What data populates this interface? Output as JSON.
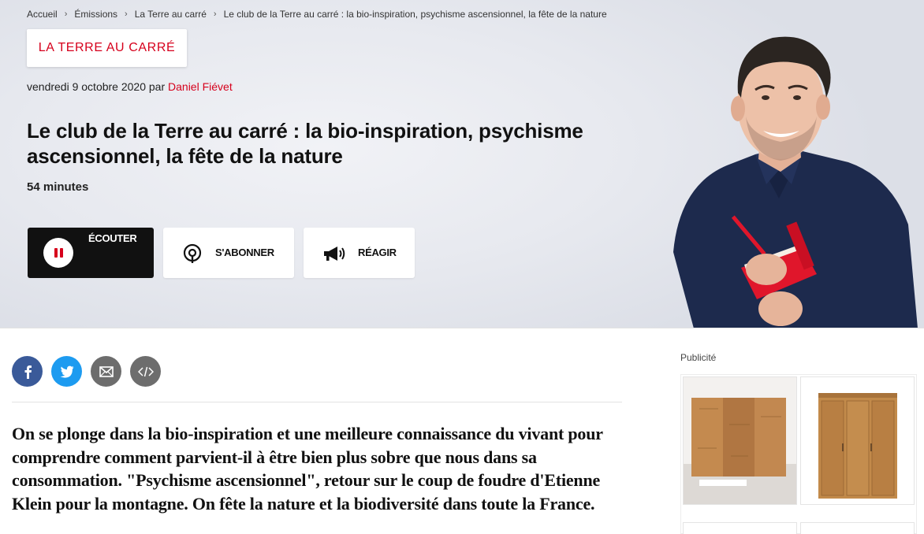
{
  "breadcrumb": {
    "items": [
      "Accueil",
      "Émissions",
      "La Terre au carré",
      "Le club de la Terre au carré : la bio-inspiration, psychisme ascensionnel, la fête de la nature"
    ]
  },
  "show": {
    "tag_label": "LA TERRE AU CARRÉ"
  },
  "meta": {
    "date_prefix": "vendredi 9 octobre 2020",
    "by": "par",
    "author": "Daniel Fiévet"
  },
  "episode": {
    "title": "Le club de la Terre au carré : la bio-inspiration, psychisme ascensionnel, la fête de la nature",
    "duration": "54 minutes"
  },
  "actions": {
    "listen": "ÉCOUTER",
    "subscribe": "S'ABONNER",
    "react": "RÉAGIR"
  },
  "description": "On se plonge dans la bio-inspiration et une meilleure connaissance du vivant pour comprendre comment parvient-il à être bien plus sobre que nous dans sa consommation. \"Psychisme ascensionnel\", retour sur le coup de foudre d'Etienne Klein pour la montagne. On fête la nature et la biodiversité dans toute la France.",
  "sidebar": {
    "ad_label": "Publicité"
  },
  "colors": {
    "brand_red": "#d6001c",
    "facebook": "#3a5a99",
    "twitter": "#1d9bf0",
    "neutral_share": "#6d6d6d"
  },
  "icons": [
    "chevron-right-icon",
    "pause-icon",
    "podcast-icon",
    "megaphone-icon",
    "facebook-icon",
    "twitter-icon",
    "mail-icon",
    "embed-code-icon",
    "ad-choices-icon",
    "close-icon"
  ]
}
